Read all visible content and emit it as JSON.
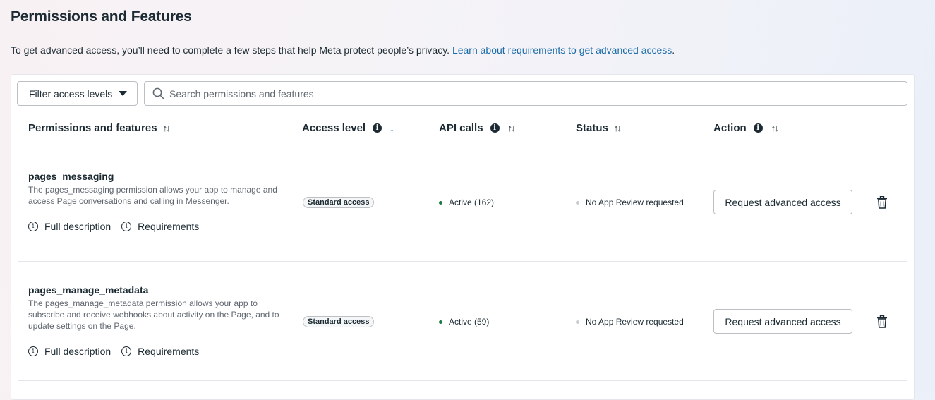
{
  "header": {
    "title": "Permissions and Features",
    "intro_text": "To get advanced access, you’ll need to complete a few steps that help Meta protect people’s privacy. ",
    "intro_link": "Learn about requirements to get advanced access",
    "intro_end": "."
  },
  "toolbar": {
    "filter_label": "Filter access levels",
    "search_placeholder": "Search permissions and features"
  },
  "table": {
    "columns": {
      "permissions": "Permissions and features",
      "access_level": "Access level",
      "api_calls": "API calls",
      "status": "Status",
      "action": "Action"
    },
    "sort_glyph": "↑↓",
    "sort_active_glyph": "↓",
    "info_glyph": "i",
    "rows": [
      {
        "name": "pages_messaging",
        "description": "The pages_messaging permission allows your app to manage and access Page conversations and calling in Messenger.",
        "full_description_label": "Full description",
        "requirements_label": "Requirements",
        "access_level": "Standard access",
        "api_calls": "Active (162)",
        "status": "No App Review requested",
        "action_label": "Request advanced access"
      },
      {
        "name": "pages_manage_metadata",
        "description": "The pages_manage_metadata permission allows your app to subscribe and receive webhooks about activity on the Page, and to update settings on the Page.",
        "full_description_label": "Full description",
        "requirements_label": "Requirements",
        "access_level": "Standard access",
        "api_calls": "Active (59)",
        "status": "No App Review requested",
        "action_label": "Request advanced access"
      }
    ]
  },
  "colors": {
    "active_dot": "#1e7a43",
    "status_dot": "#c9ccd1",
    "link": "#1a6aa8"
  }
}
